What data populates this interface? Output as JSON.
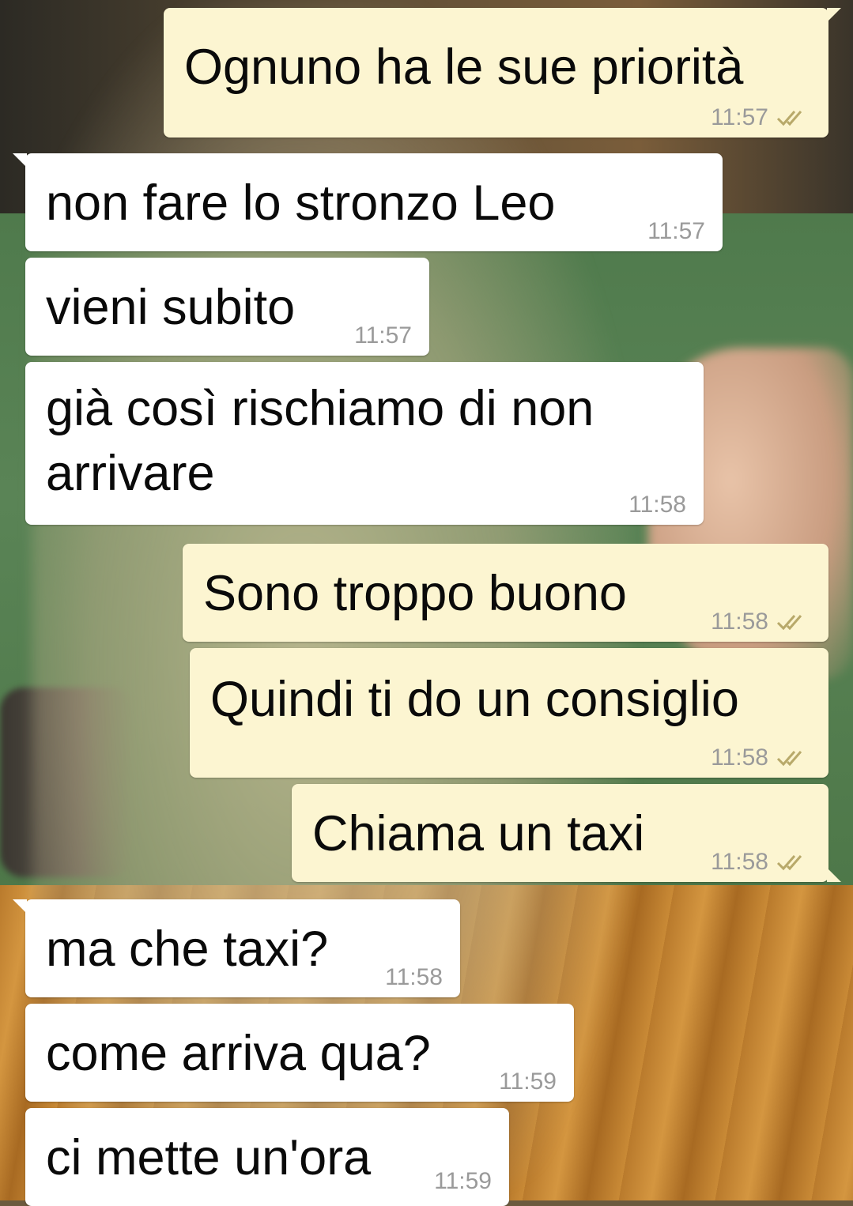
{
  "colors": {
    "incoming_bubble": "#ffffff",
    "outgoing_bubble": "#fcf5d1",
    "time_text": "#9a9a9a",
    "ticks": "#b8a96a"
  },
  "messages": [
    {
      "direction": "out",
      "text": "Ognuno ha le sue priorità",
      "time": "11:57",
      "status_icon": "double-check-icon"
    },
    {
      "direction": "in",
      "text": "non fare lo stronzo Leo",
      "time": "11:57"
    },
    {
      "direction": "in",
      "text": "vieni subito",
      "time": "11:57"
    },
    {
      "direction": "in",
      "text": "già così rischiamo di non",
      "text_line2": "arrivare",
      "time": "11:58"
    },
    {
      "direction": "out",
      "text": "Sono troppo buono",
      "time": "11:58",
      "status_icon": "double-check-icon"
    },
    {
      "direction": "out",
      "text": "Quindi ti do un consiglio",
      "time": "11:58",
      "status_icon": "double-check-icon"
    },
    {
      "direction": "out",
      "text": "Chiama un taxi",
      "time": "11:58",
      "status_icon": "double-check-icon"
    },
    {
      "direction": "in",
      "text": "ma che taxi?",
      "time": "11:58"
    },
    {
      "direction": "in",
      "text": "come arriva qua?",
      "time": "11:59"
    },
    {
      "direction": "in",
      "text": "ci mette un'ora",
      "time": "11:59"
    }
  ]
}
